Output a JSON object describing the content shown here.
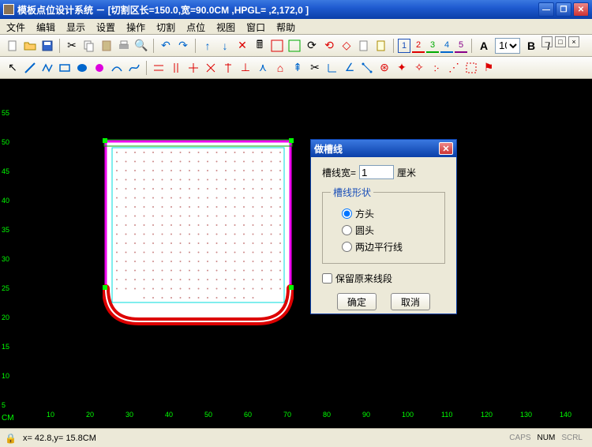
{
  "titlebar": {
    "title": "模板点位设计系统 － [切割区长=150.0,宽=90.0CM ,HPGL= ,2,172,0 ]"
  },
  "menu": [
    "文件",
    "编辑",
    "显示",
    "设置",
    "操作",
    "切割",
    "点位",
    "视图",
    "窗口",
    "帮助"
  ],
  "toolbar": {
    "numtabs": [
      {
        "n": "1",
        "color": "#1a4fb8",
        "active": true
      },
      {
        "n": "2",
        "color": "#d00"
      },
      {
        "n": "3",
        "color": "#0a0"
      },
      {
        "n": "4",
        "color": "#06c"
      },
      {
        "n": "5",
        "color": "#808"
      }
    ],
    "font_label": "A",
    "font_size": "10"
  },
  "ruler_v": [
    5,
    10,
    15,
    20,
    25,
    30,
    35,
    40,
    45,
    50,
    55
  ],
  "ruler_h": [
    10,
    20,
    30,
    40,
    50,
    60,
    70,
    80,
    90,
    100,
    110,
    120,
    130,
    140
  ],
  "cm": "CM",
  "dialog": {
    "title": "做槽线",
    "width_label": "槽线宽=",
    "width_value": "1",
    "unit": "厘米",
    "group_label": "槽线形状",
    "options": [
      {
        "label": "方头",
        "checked": true
      },
      {
        "label": "圆头",
        "checked": false
      },
      {
        "label": "两边平行线",
        "checked": false
      }
    ],
    "keep_label": "保留原来线段",
    "ok": "确定",
    "cancel": "取消"
  },
  "status": {
    "coords": "x= 42.8,y= 15.8CM",
    "caps": "CAPS",
    "num": "NUM",
    "scrl": "SCRL"
  }
}
